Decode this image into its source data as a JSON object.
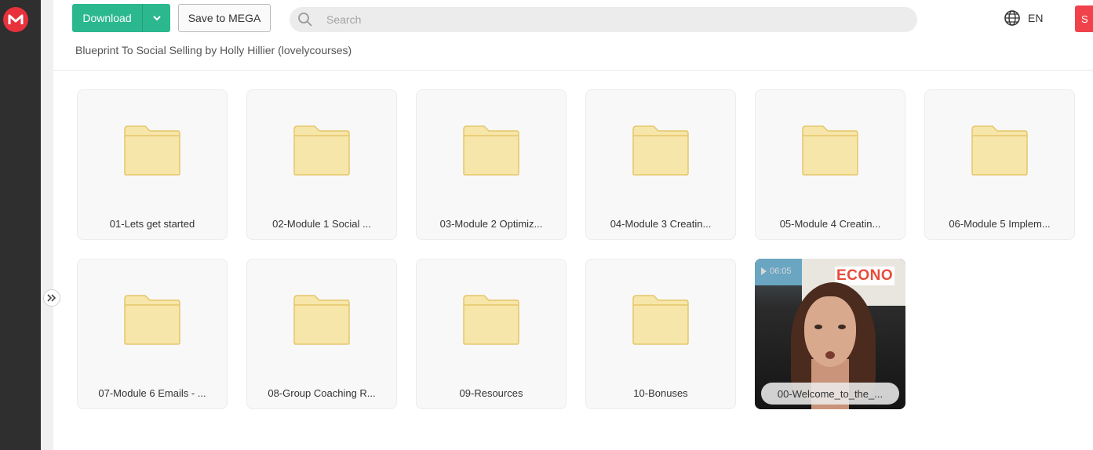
{
  "app": {
    "logo_letter": "M"
  },
  "toolbar": {
    "download_label": "Download",
    "save_label": "Save to MEGA",
    "search_placeholder": "Search",
    "language": "EN",
    "red_button_label": "S"
  },
  "breadcrumb": "Blueprint To Social Selling by Holly Hillier  (lovelycourses)",
  "folders": [
    {
      "name": "01-Lets get started"
    },
    {
      "name": "02-Module 1 Social ..."
    },
    {
      "name": "03-Module 2 Optimiz..."
    },
    {
      "name": "04-Module 3 Creatin..."
    },
    {
      "name": "05-Module 4 Creatin..."
    },
    {
      "name": "06-Module 5 Implem..."
    },
    {
      "name": "07-Module 6 Emails - ..."
    },
    {
      "name": "08-Group Coaching R..."
    },
    {
      "name": "09-Resources"
    },
    {
      "name": "10-Bonuses"
    }
  ],
  "video": {
    "name": "00-Welcome_to_the_...",
    "duration": "06:05",
    "overlay_text": "ECONO"
  },
  "colors": {
    "download_green": "#2bb88f",
    "brand_red": "#e8313b",
    "folder_yellow": "#f7e6a9"
  }
}
